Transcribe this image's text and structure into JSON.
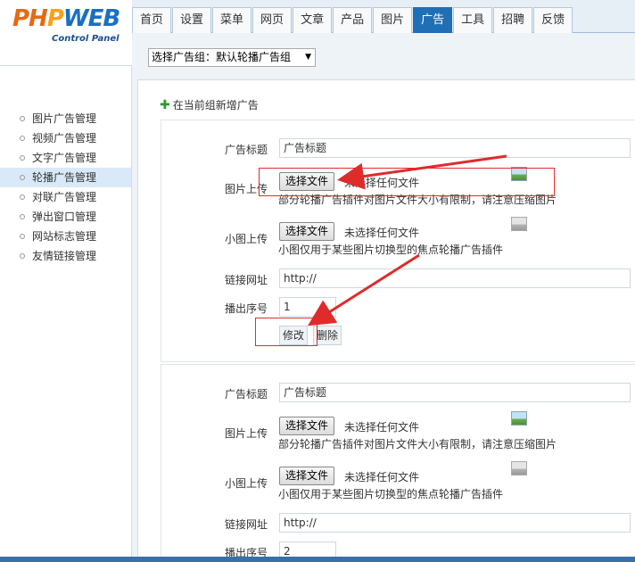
{
  "logo": {
    "part1": "PH",
    "part2": "P",
    "part3": "WEB",
    "subtitle": "Control Panel"
  },
  "nav": {
    "tabs": [
      "首页",
      "设置",
      "菜单",
      "网页",
      "文章",
      "产品",
      "图片",
      "广告",
      "工具",
      "招聘",
      "反馈"
    ],
    "active": "广告"
  },
  "sidebar": {
    "items": [
      "图片广告管理",
      "视频广告管理",
      "文字广告管理",
      "轮播广告管理",
      "对联广告管理",
      "弹出窗口管理",
      "网站标志管理",
      "友情链接管理"
    ],
    "active": "轮播广告管理"
  },
  "group_select": {
    "value": "选择广告组：默认轮播广告组"
  },
  "add_link": "在当前组新增广告",
  "ads": [
    {
      "title_label": "广告标题",
      "title_value": "广告标题",
      "image_label": "图片上传",
      "file_button": "选择文件",
      "file_none": "未选择任何文件",
      "image_hint": "部分轮播广告插件对图片文件大小有限制，请注意压缩图片",
      "thumb_label": "小图上传",
      "thumb_file_button": "选择文件",
      "thumb_file_none": "未选择任何文件",
      "thumb_hint": "小图仅用于某些图片切换型的焦点轮播广告插件",
      "link_label": "链接网址",
      "link_value": "http://",
      "order_label": "播出序号",
      "order_value": "1",
      "edit_button": "修改",
      "delete_button": "删除"
    },
    {
      "title_label": "广告标题",
      "title_value": "广告标题",
      "image_label": "图片上传",
      "file_button": "选择文件",
      "file_none": "未选择任何文件",
      "image_hint": "部分轮播广告插件对图片文件大小有限制，请注意压缩图片",
      "thumb_label": "小图上传",
      "thumb_file_button": "选择文件",
      "thumb_file_none": "未选择任何文件",
      "thumb_hint": "小图仅用于某些图片切换型的焦点轮播广告插件",
      "link_label": "链接网址",
      "link_value": "http://",
      "order_label": "播出序号",
      "order_value": "2"
    }
  ],
  "colors": {
    "active_tab": "#1f6fb6",
    "annotation": "#e02b2b",
    "sidebar_active": "#d9e9f7"
  },
  "icons": {
    "add": "plus-icon",
    "image_preview": "image-icon",
    "image_placeholder": "image-placeholder-icon"
  }
}
